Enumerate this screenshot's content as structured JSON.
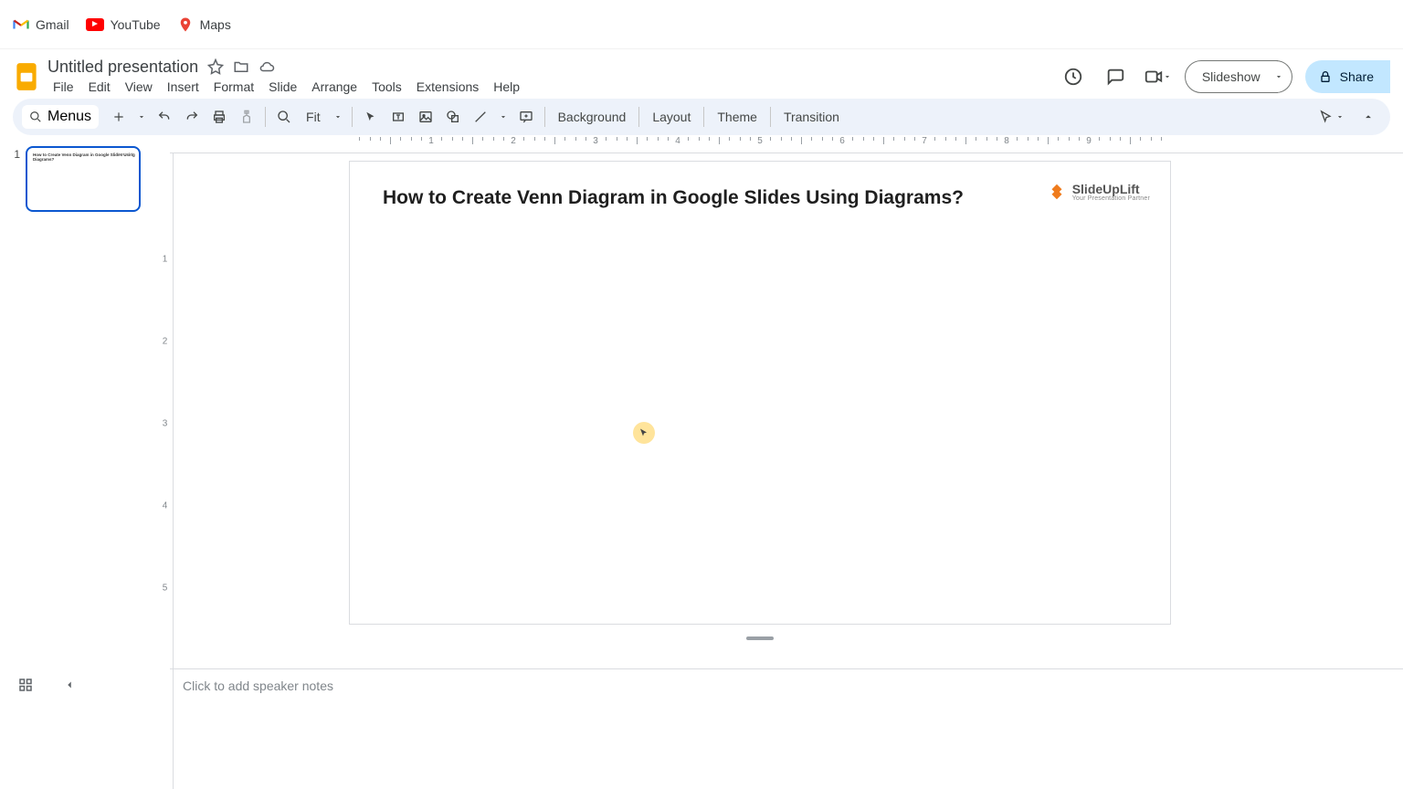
{
  "bookmarks": {
    "gmail": "Gmail",
    "youtube": "YouTube",
    "maps": "Maps"
  },
  "doc": {
    "title": "Untitled presentation"
  },
  "menu": {
    "file": "File",
    "edit": "Edit",
    "view": "View",
    "insert": "Insert",
    "format": "Format",
    "slide": "Slide",
    "arrange": "Arrange",
    "tools": "Tools",
    "extensions": "Extensions",
    "help": "Help"
  },
  "header_actions": {
    "slideshow": "Slideshow",
    "share": "Share"
  },
  "toolbar": {
    "menus": "Menus",
    "zoom": "Fit",
    "background": "Background",
    "layout": "Layout",
    "theme": "Theme",
    "transition": "Transition"
  },
  "ruler": {
    "h_labels": [
      "1",
      "2",
      "3",
      "4",
      "5",
      "6",
      "7",
      "8",
      "9"
    ],
    "v_labels": [
      "1",
      "2",
      "3",
      "4",
      "5"
    ]
  },
  "filmstrip": {
    "slides": [
      {
        "num": "1"
      }
    ]
  },
  "slide": {
    "title": "How to Create Venn Diagram in Google Slides Using Diagrams?",
    "logo": {
      "name": "SlideUpLift",
      "tagline": "Your Presentation Partner"
    }
  },
  "notes": {
    "placeholder": "Click to add speaker notes"
  }
}
